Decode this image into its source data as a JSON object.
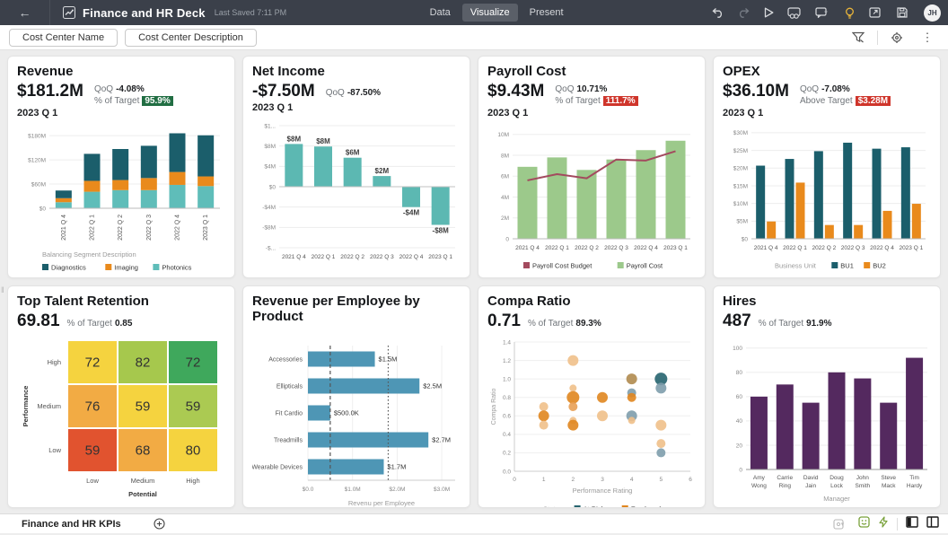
{
  "topbar": {
    "title": "Finance and HR Deck",
    "last_saved": "Last Saved 7:11 PM",
    "tabs": [
      {
        "label": "Data"
      },
      {
        "label": "Visualize"
      },
      {
        "label": "Present"
      }
    ],
    "active_tab": "Visualize",
    "avatar_initials": "JH"
  },
  "filterbar": {
    "chips": [
      {
        "label": "Cost Center Name"
      },
      {
        "label": "Cost Center Description"
      }
    ]
  },
  "bottombar": {
    "page_tab": "Finance and HR KPIs"
  },
  "colors": {
    "topbar_bg": "#3b404a",
    "badge_green": "#216e43",
    "badge_red": "#cf352b",
    "teal_dark": "#1b5e6b",
    "teal_light": "#5fbdb9",
    "orange": "#e98a1c",
    "net_income_teal": "#5cb8b2",
    "payroll_green": "#9cc98b",
    "budget_maroon": "#a34a5e",
    "hbar_blue": "#4e96b5",
    "hires_purple": "#54295f"
  },
  "icons": {
    "kebab": "⋮",
    "caret_down": "▾",
    "back_arrow": "←"
  },
  "cards": [
    {
      "title": "Revenue",
      "kpi": "$181.2M",
      "period": "2023 Q 1",
      "metrics": [
        {
          "label": "QoQ",
          "value": "-4.08%"
        },
        {
          "label": "% of Target",
          "value": "95.9%"
        }
      ],
      "chart": {
        "type": "stacked-bar",
        "categories": [
          "2021 Q 4",
          "2022 Q 1",
          "2022 Q 2",
          "2022 Q 3",
          "2022 Q 4",
          "2023 Q 1"
        ],
        "series": [
          {
            "name": "Photonics",
            "color": "#5fbdb9",
            "values": [
              15,
              41,
              45,
              45,
              58,
              55
            ]
          },
          {
            "name": "Imaging",
            "color": "#e98a1c",
            "values": [
              10,
              27,
              25,
              30,
              32,
              24
            ]
          },
          {
            "name": "Diagnostics",
            "color": "#1b5e6b",
            "values": [
              19,
              67,
              77,
              80,
              96,
              102
            ]
          }
        ],
        "yticks": [
          {
            "v": 0,
            "l": "$0"
          },
          {
            "v": 60,
            "l": "$60M"
          },
          {
            "v": 120,
            "l": "$120M"
          },
          {
            "v": 180,
            "l": "$180M"
          }
        ],
        "ymax": 196,
        "legend_title": "Balancing Segment Description",
        "legend": [
          {
            "label": "Diagnostics",
            "color": "#1b5e6b"
          },
          {
            "label": "Imaging",
            "color": "#e98a1c"
          },
          {
            "label": "Photonics",
            "color": "#5fbdb9"
          }
        ]
      }
    },
    {
      "title": "Net Income",
      "kpi": "-$7.50M",
      "period": "2023 Q 1",
      "metrics": [
        {
          "label": "QoQ",
          "value": "-87.50%"
        }
      ],
      "chart": {
        "type": "bar-labeled",
        "categories": [
          "2021 Q 4",
          "2022 Q 1",
          "2022 Q 2",
          "2022 Q 3",
          "2022 Q 4",
          "2023 Q 1"
        ],
        "values": [
          8.4,
          7.9,
          5.7,
          2.1,
          -4.0,
          -7.5
        ],
        "labels": [
          "$8M",
          "$8M",
          "$6M",
          "$2M",
          "-$4M",
          "-$8M"
        ],
        "color": "#5cb8b2",
        "yticks": [
          {
            "v": 12,
            "l": "$1..."
          },
          {
            "v": 8,
            "l": "$8M"
          },
          {
            "v": 4,
            "l": "$4M"
          },
          {
            "v": 0,
            "l": "$0"
          },
          {
            "v": -4,
            "l": "-$4M"
          },
          {
            "v": -8,
            "l": "-$8M"
          },
          {
            "v": -12,
            "l": "-$..."
          }
        ],
        "yrange": [
          -12,
          12
        ]
      }
    },
    {
      "title": "Payroll Cost",
      "kpi": "$9.43M",
      "period": "2023 Q 1",
      "metrics": [
        {
          "label": "QoQ",
          "value": "10.71%"
        },
        {
          "label": "% of Target",
          "value": "111.7%"
        }
      ],
      "chart": {
        "type": "bar-line",
        "categories": [
          "2021 Q 4",
          "2022 Q 1",
          "2022 Q 2",
          "2022 Q 3",
          "2022 Q 4",
          "2023 Q 1"
        ],
        "bars": {
          "name": "Payroll Cost",
          "color": "#9cc98b",
          "values": [
            6.9,
            7.8,
            6.6,
            7.6,
            8.5,
            9.4
          ]
        },
        "line": {
          "name": "Payroll Cost Budget",
          "color": "#a34a5e",
          "values": [
            5.6,
            6.2,
            5.8,
            7.6,
            7.5,
            8.4
          ]
        },
        "yticks": [
          {
            "v": 0,
            "l": "0"
          },
          {
            "v": 2,
            "l": "2M"
          },
          {
            "v": 4,
            "l": "4M"
          },
          {
            "v": 6,
            "l": "6M"
          },
          {
            "v": 8,
            "l": "8M"
          },
          {
            "v": 10,
            "l": "10M"
          }
        ],
        "ymax": 10.5
      }
    },
    {
      "title": "OPEX",
      "kpi": "$36.10M",
      "period": "2023 Q 1",
      "metrics": [
        {
          "label": "QoQ",
          "value": "-7.08%"
        },
        {
          "label": "Above Target",
          "value": "$3.28M"
        }
      ],
      "chart": {
        "type": "grouped-bar",
        "categories": [
          "2021 Q 4",
          "2022 Q 1",
          "2022 Q 2",
          "2022 Q 3",
          "2022 Q 4",
          "2023 Q 1"
        ],
        "series": [
          {
            "name": "BU1",
            "color": "#1b5e6b",
            "values": [
              20.7,
              22.6,
              24.8,
              27.2,
              25.5,
              25.9
            ]
          },
          {
            "name": "BU2",
            "color": "#e98a1c",
            "values": [
              4.9,
              15.9,
              3.9,
              3.9,
              7.9,
              9.9
            ]
          }
        ],
        "yticks": [
          {
            "v": 0,
            "l": "$0"
          },
          {
            "v": 5,
            "l": "$5M"
          },
          {
            "v": 10,
            "l": "$10M"
          },
          {
            "v": 15,
            "l": "$15M"
          },
          {
            "v": 20,
            "l": "$20M"
          },
          {
            "v": 25,
            "l": "$25M"
          },
          {
            "v": 30,
            "l": "$30M"
          }
        ],
        "ymax": 31,
        "legend_title": "Business Unit"
      }
    },
    {
      "title": "Top Talent Retention",
      "kpi": "69.81",
      "period": "",
      "metrics": [
        {
          "label": "% of Target",
          "value": "0.85"
        }
      ],
      "chart": {
        "type": "heatmap",
        "rows": [
          "High",
          "Medium",
          "Low"
        ],
        "cols": [
          "Low",
          "Medium",
          "High"
        ],
        "values": [
          [
            72,
            82,
            72
          ],
          [
            76,
            59,
            59
          ],
          [
            59,
            68,
            80
          ]
        ],
        "cell_colors": [
          [
            "#f5d33f",
            "#a6c84d",
            "#3fa85c"
          ],
          [
            "#f2ab44",
            "#f5d33f",
            "#abca52"
          ],
          [
            "#e1532f",
            "#f2ab44",
            "#f5d33f"
          ]
        ],
        "xlabel": "Potential",
        "ylabel": "Performance"
      }
    },
    {
      "title": "Revenue per Employee by Product",
      "kpi": "",
      "period": "",
      "metrics": [],
      "chart": {
        "type": "hbar",
        "categories": [
          "Accessories",
          "Ellipticals",
          "Fit Cardio",
          "Treadmills",
          "Wearable Devices"
        ],
        "values": [
          1.5,
          2.5,
          0.5,
          2.7,
          1.7
        ],
        "labels": [
          "$1.5M",
          "$2.5M",
          "$500.0K",
          "$2.7M",
          "$1.7M"
        ],
        "color": "#4e96b5",
        "xticks": [
          {
            "v": 0,
            "l": "$0.0"
          },
          {
            "v": 1,
            "l": "$1.0M"
          },
          {
            "v": 2,
            "l": "$2.0M"
          },
          {
            "v": 3,
            "l": "$3.0M"
          }
        ],
        "xmax": 3.3,
        "ref_lines": [
          {
            "v": 0.5,
            "style": "dashed"
          },
          {
            "v": 1.8,
            "style": "dotted"
          }
        ],
        "xlabel": "Revenu per Employee"
      }
    },
    {
      "title": "Compa Ratio",
      "kpi": "0.71",
      "period": "",
      "metrics": [
        {
          "label": "% of Target",
          "value": "89.3%"
        }
      ],
      "chart": {
        "type": "scatter",
        "palette": {
          "lo": "#f0c08a",
          "do": "#e0861f",
          "mo": "#e8a055",
          "bg": "#7e9dac",
          "tl": "#26646f",
          "ov": "#b08b4f"
        },
        "points": [
          {
            "x": 1,
            "y": 0.7,
            "c": "lo",
            "r": 5
          },
          {
            "x": 1,
            "y": 0.6,
            "c": "do",
            "r": 6
          },
          {
            "x": 1,
            "y": 0.5,
            "c": "lo",
            "r": 5
          },
          {
            "x": 2,
            "y": 1.2,
            "c": "lo",
            "r": 6
          },
          {
            "x": 2,
            "y": 0.9,
            "c": "lo",
            "r": 4
          },
          {
            "x": 2,
            "y": 0.8,
            "c": "do",
            "r": 7
          },
          {
            "x": 2,
            "y": 0.7,
            "c": "mo",
            "r": 5
          },
          {
            "x": 2,
            "y": 0.55,
            "c": "lo",
            "r": 4
          },
          {
            "x": 2,
            "y": 0.5,
            "c": "do",
            "r": 6
          },
          {
            "x": 3,
            "y": 0.8,
            "c": "do",
            "r": 6
          },
          {
            "x": 3,
            "y": 0.6,
            "c": "lo",
            "r": 6
          },
          {
            "x": 4,
            "y": 1.0,
            "c": "ov",
            "r": 6
          },
          {
            "x": 4,
            "y": 0.85,
            "c": "bg",
            "r": 5
          },
          {
            "x": 4,
            "y": 0.8,
            "c": "do",
            "r": 5
          },
          {
            "x": 4,
            "y": 0.6,
            "c": "bg",
            "r": 6
          },
          {
            "x": 4,
            "y": 0.55,
            "c": "lo",
            "r": 4
          },
          {
            "x": 5,
            "y": 1.0,
            "c": "tl",
            "r": 7
          },
          {
            "x": 5,
            "y": 0.9,
            "c": "bg",
            "r": 6
          },
          {
            "x": 5,
            "y": 0.5,
            "c": "lo",
            "r": 6
          },
          {
            "x": 5,
            "y": 0.3,
            "c": "lo",
            "r": 5
          },
          {
            "x": 5,
            "y": 0.2,
            "c": "bg",
            "r": 5
          }
        ],
        "xticks": [
          0,
          1,
          2,
          3,
          4,
          5,
          6
        ],
        "yticks": [
          0.0,
          0.2,
          0.4,
          0.6,
          0.8,
          1.0,
          1.2,
          1.4
        ],
        "xlabel": "Performance Rating",
        "ylabel": "Compa Ratio",
        "legend_title": "Status",
        "legend": [
          {
            "label": "At Risk",
            "color": "#26646f"
          },
          {
            "label": "Employed",
            "color": "#e0861f"
          }
        ]
      }
    },
    {
      "title": "Hires",
      "kpi": "487",
      "period": "",
      "metrics": [
        {
          "label": "% of Target",
          "value": "91.9%"
        }
      ],
      "chart": {
        "type": "bar",
        "categories": [
          "Amy Wong",
          "Carrie Ring",
          "David Jain",
          "Doug Lock",
          "John Smith",
          "Steve Mack",
          "Tim Hardy"
        ],
        "values": [
          60,
          70,
          55,
          80,
          75,
          55,
          92
        ],
        "color": "#54295f",
        "yticks": [
          {
            "v": 0,
            "l": "0"
          },
          {
            "v": 20,
            "l": "20"
          },
          {
            "v": 40,
            "l": "40"
          },
          {
            "v": 60,
            "l": "60"
          },
          {
            "v": 80,
            "l": "80"
          },
          {
            "v": 100,
            "l": "100"
          }
        ],
        "ymax": 105,
        "xlabel": "Manager"
      }
    }
  ]
}
